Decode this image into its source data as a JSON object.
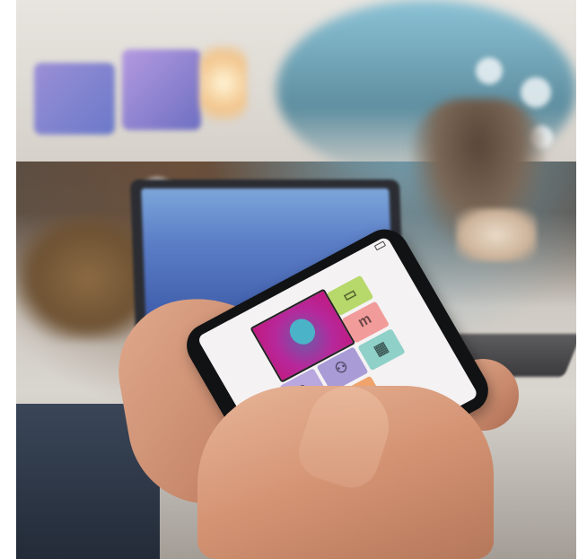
{
  "scene": {
    "description_name": "photo",
    "phone_app": {
      "brand": "",
      "tiles": [
        {
          "id": "hero",
          "label": "",
          "color": "#c2187f",
          "icon": "wrench-screwdriver-icon"
        },
        {
          "id": "green1",
          "label": "",
          "color": "#b7d86a",
          "icon": "card-icon"
        },
        {
          "id": "pink",
          "label": "",
          "color": "#f29b9b",
          "glyph": "m"
        },
        {
          "id": "magenta",
          "label": "",
          "color": "#c4357a",
          "icon": "heart-icon"
        },
        {
          "id": "lav1",
          "label": "",
          "color": "#b9a7df",
          "icon": "apple-icon"
        },
        {
          "id": "lav2",
          "label": "",
          "color": "#a99bd6",
          "icon": "people-icon"
        },
        {
          "id": "green2",
          "label": "",
          "color": "#7cc04a",
          "icon": "bus-icon"
        },
        {
          "id": "lime",
          "label": "",
          "color": "#a6d35a",
          "icon": "building-icon"
        },
        {
          "id": "orange",
          "label": "",
          "color": "#f0a36b",
          "icon": "map-icon"
        },
        {
          "id": "teal",
          "label": "",
          "color": "#8fd0c8",
          "icon": "grid-icon"
        }
      ]
    }
  },
  "colors": {
    "accent": "#c2187f",
    "background": "#d9d5cf"
  }
}
